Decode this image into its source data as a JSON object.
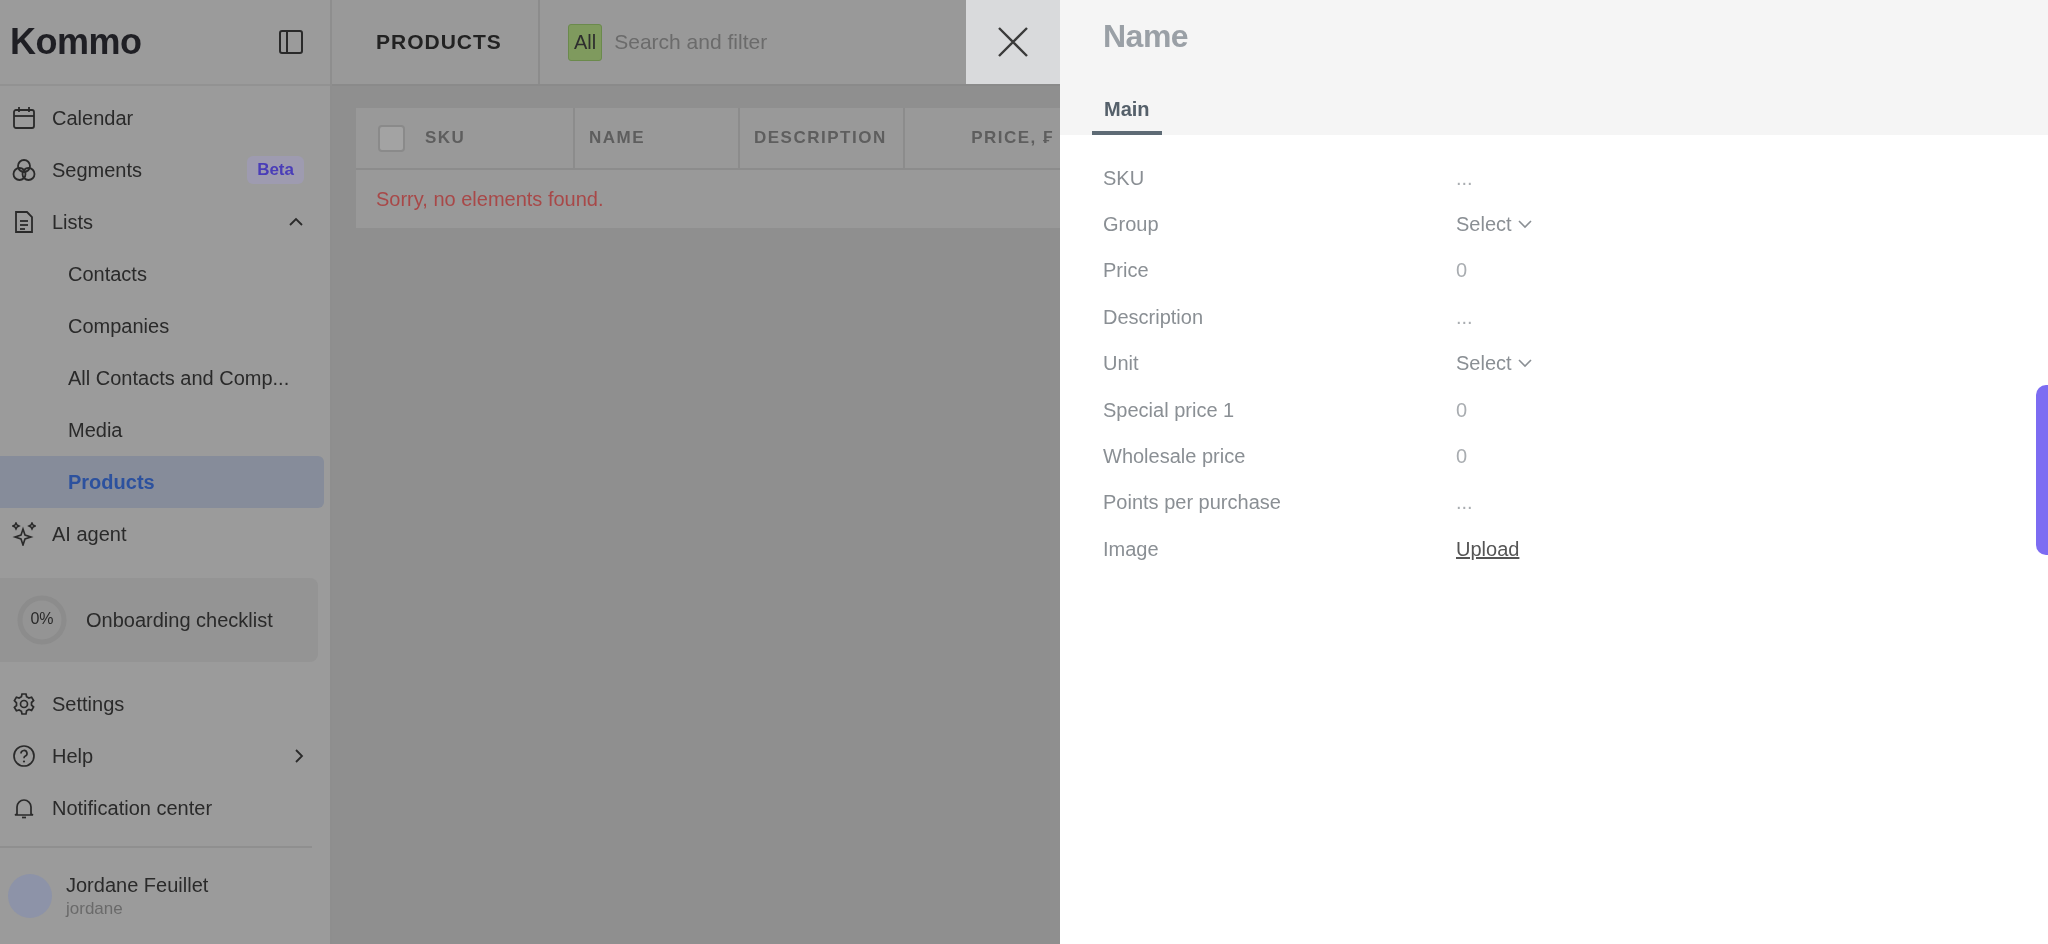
{
  "sidebar": {
    "logo": "Kommo",
    "items": [
      {
        "label": "Calendar",
        "selected": false
      },
      {
        "label": "Segments",
        "badge": "Beta",
        "selected": false
      },
      {
        "label": "Lists",
        "expanded": true,
        "selected": false,
        "children": [
          {
            "label": "Contacts",
            "selected": false
          },
          {
            "label": "Companies",
            "selected": false
          },
          {
            "label": "All Contacts and Comp...",
            "selected": false
          },
          {
            "label": "Media",
            "selected": false
          },
          {
            "label": "Products",
            "selected": true
          }
        ]
      },
      {
        "label": "AI agent",
        "selected": false
      }
    ],
    "onboarding": {
      "percent": "0%",
      "label": "Onboarding checklist",
      "level": 0
    },
    "bottom_items": [
      {
        "label": "Settings",
        "submenu": false
      },
      {
        "label": "Help",
        "submenu": true
      },
      {
        "label": "Notification center",
        "submenu": false
      }
    ],
    "user": {
      "name": "Jordane Feuillet",
      "login": "jordane"
    }
  },
  "page_title": "PRODUCTS",
  "search": {
    "tag": "All",
    "placeholder": "Search and filter"
  },
  "table": {
    "select_all_checked": false,
    "columns": [
      "SKU",
      "NAME",
      "DESCRIPTION",
      "PRICE, ₣"
    ],
    "empty_message": "Sorry, no elements found."
  },
  "panel": {
    "title": "Name",
    "tabs": [
      {
        "label": "Main",
        "selected": true
      }
    ],
    "fields": [
      {
        "label": "SKU",
        "kind": "text",
        "placeholder": "..."
      },
      {
        "label": "Group",
        "kind": "select",
        "placeholder": "Select"
      },
      {
        "label": "Price",
        "kind": "text",
        "placeholder": "0"
      },
      {
        "label": "Description",
        "kind": "text",
        "placeholder": "..."
      },
      {
        "label": "Unit",
        "kind": "select",
        "placeholder": "Select"
      },
      {
        "label": "Special price 1",
        "kind": "text",
        "placeholder": "0"
      },
      {
        "label": "Wholesale price",
        "kind": "text",
        "placeholder": "0"
      },
      {
        "label": "Points per purchase",
        "kind": "text",
        "placeholder": "..."
      },
      {
        "label": "Image",
        "kind": "link",
        "value": "Upload"
      }
    ]
  }
}
